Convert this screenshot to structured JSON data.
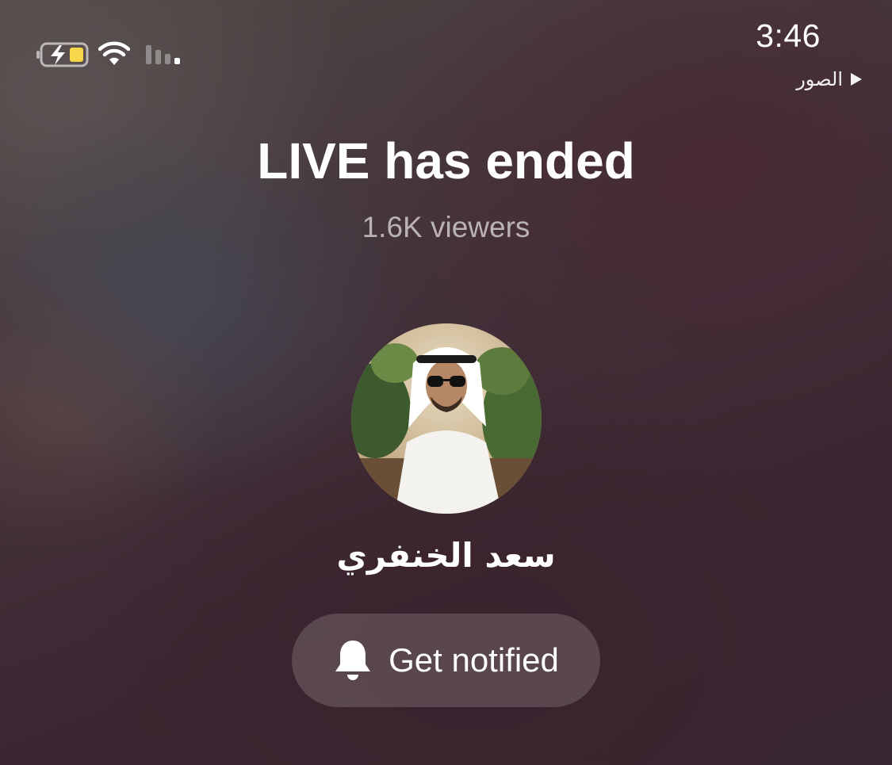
{
  "status_bar": {
    "time": "3:46",
    "back_app_label": "الصور",
    "icons": [
      "battery-charging-icon",
      "wifi-icon",
      "cellular-signal-icon",
      "play-triangle-icon"
    ]
  },
  "live_end": {
    "title": "LIVE has ended",
    "viewers": "1.6K viewers",
    "username": "سعد الخنفري",
    "notify_label": "Get notified"
  },
  "colors": {
    "background": "#3a2630",
    "battery_fill": "#f7d64a",
    "muted_text": "#b9b2b6",
    "button_bg": "rgba(255,255,255,0.16)"
  }
}
